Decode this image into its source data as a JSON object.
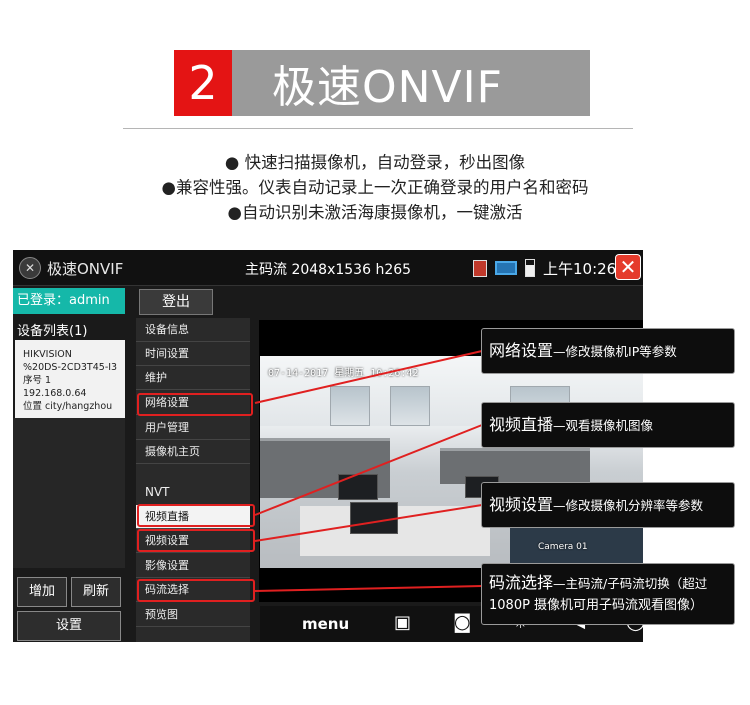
{
  "header": {
    "number": "2",
    "title": "极速ONVIF",
    "bullets": [
      "● 快速扫描摄像机，自动登录，秒出图像",
      "●兼容性强。仪表自动记录上一次正确登录的用户名和密码",
      "●自动识别未激活海康摄像机，一键激活"
    ]
  },
  "device": {
    "app_name": "极速ONVIF",
    "stream_info": "主码流  2048x1536 h265",
    "clock": "上午10:26",
    "close_symbol": "✕",
    "login_status": "已登录：admin",
    "logout_label": "登出",
    "device_list_title": "设备列表(1)",
    "device_card": {
      "brand": "HIKVISION",
      "model": "%20DS-2CD3T45-I3",
      "seq": "序号  1",
      "ip": "192.168.0.64",
      "location": "位置  city/hangzhou"
    },
    "buttons": {
      "add": "增加",
      "refresh": "刷新",
      "settings": "设置"
    },
    "menu": [
      "设备信息",
      "时间设置",
      "维护",
      "网络设置",
      "用户管理",
      "摄像机主页",
      "NVT",
      "视频直播",
      "视频设置",
      "影像设置",
      "码流选择",
      "预览图"
    ],
    "video_overlay": {
      "datetime": "07-14-2017  星期五  10:26:42",
      "camera": "Camera 01"
    },
    "controls": {
      "menu": "menu"
    }
  },
  "callouts": {
    "network": {
      "title": "网络设置",
      "desc": "—修改摄像机IP等参数"
    },
    "live": {
      "title": "视频直播",
      "desc": "—观看摄像机图像"
    },
    "video": {
      "title": "视频设置",
      "desc": "—修改摄像机分辨率等参数"
    },
    "stream": {
      "title": "码流选择",
      "desc": "—主码流/子码流切换（超过",
      "desc2": "1080P 摄像机可用子码流观看图像）"
    }
  },
  "colors": {
    "accent_red": "#e41414",
    "banner_gray": "#9a9a9a",
    "login_teal": "#15b8a9",
    "highlight_red": "#e02020"
  }
}
